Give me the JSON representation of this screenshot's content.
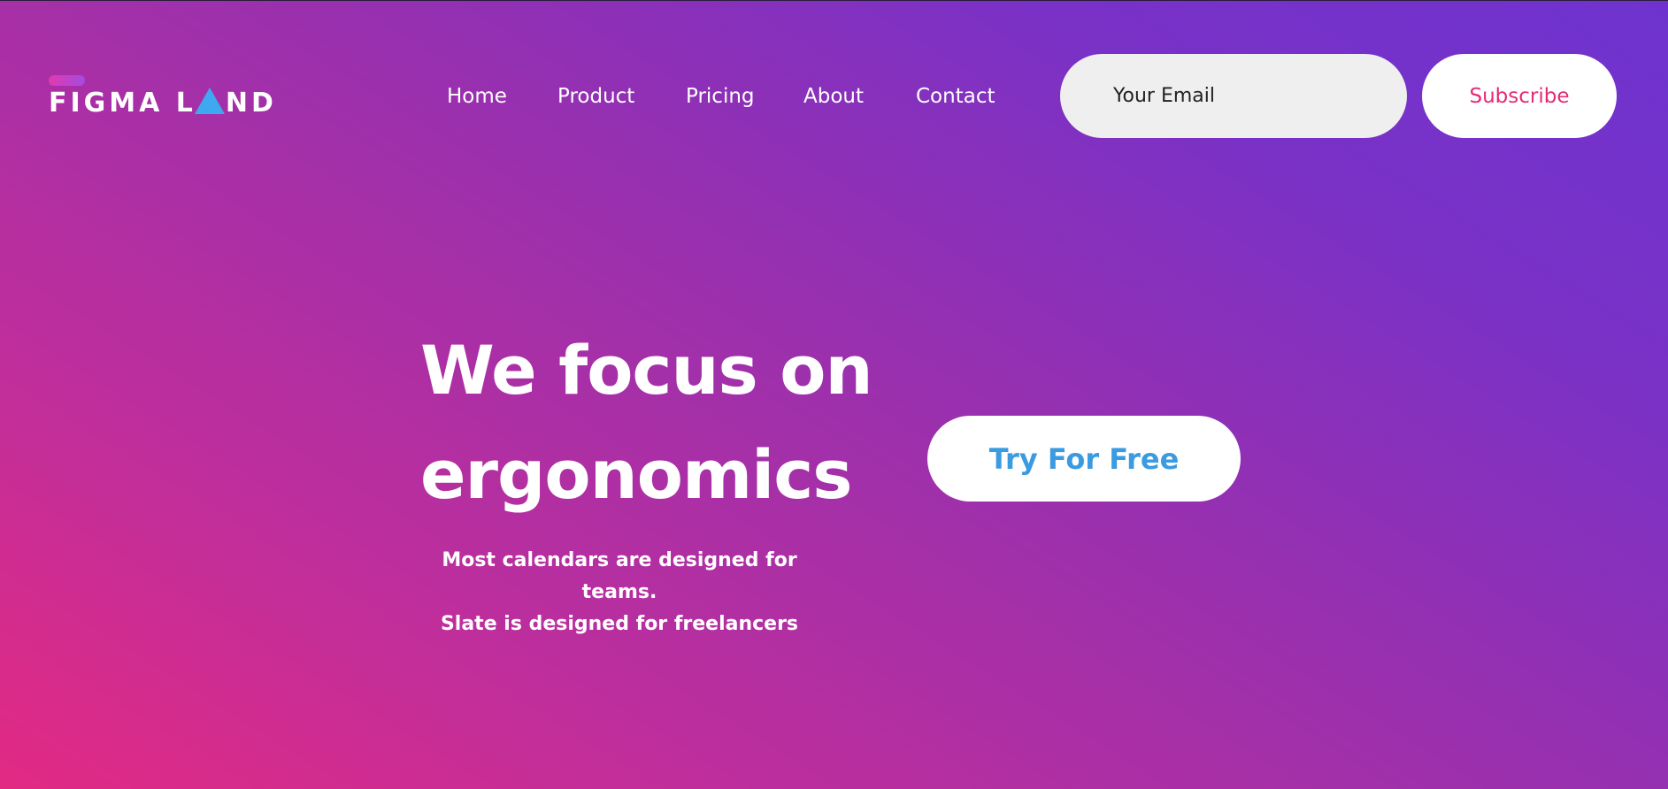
{
  "logo": {
    "text_before": "FIGMA L",
    "text_after": "ND",
    "icon": "triangle-icon",
    "accent_colors": [
      "#e03ab0",
      "#3ea8f0"
    ]
  },
  "nav": {
    "items": [
      {
        "label": "Home"
      },
      {
        "label": "Product"
      },
      {
        "label": "Pricing"
      },
      {
        "label": "About"
      },
      {
        "label": "Contact"
      }
    ]
  },
  "subscribe_form": {
    "email_placeholder": "Your Email",
    "button_label": "Subscribe",
    "button_color": "#e62a74"
  },
  "hero": {
    "title_line1": "We focus on",
    "title_line2": "ergonomics",
    "subtitle_line1": "Most calendars are designed for teams.",
    "subtitle_line2": "Slate is designed for freelancers",
    "cta_label": "Try For Free",
    "cta_color": "#3a9be0"
  },
  "theme": {
    "gradient_start": "#e22a83",
    "gradient_end": "#6e33cf"
  }
}
